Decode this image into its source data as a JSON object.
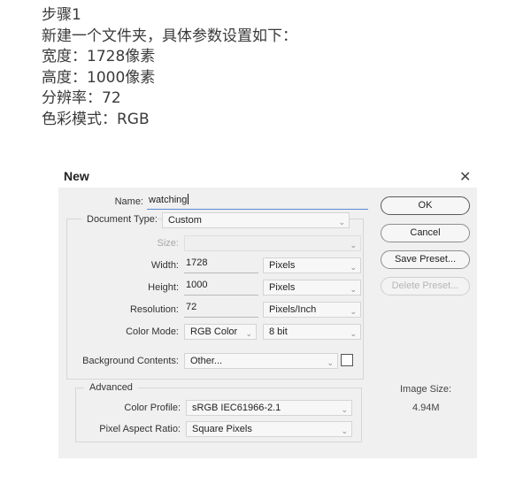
{
  "intro": {
    "lines": [
      "步骤1",
      "新建一个文件夹，具体参数设置如下：",
      "宽度：1728像素",
      "高度：1000像素",
      "分辨率：72",
      "色彩模式：RGB"
    ]
  },
  "dialog": {
    "title": "New",
    "close_glyph": "✕",
    "name_label": "Name:",
    "name_value": "watching",
    "doc_type_label": "Document Type:",
    "doc_type_value": "Custom",
    "size_label": "Size:",
    "size_value": "",
    "width_label": "Width:",
    "width_value": "1728",
    "width_unit": "Pixels",
    "height_label": "Height:",
    "height_value": "1000",
    "height_unit": "Pixels",
    "resolution_label": "Resolution:",
    "resolution_value": "72",
    "resolution_unit": "Pixels/Inch",
    "color_mode_label": "Color Mode:",
    "color_mode_value": "RGB Color",
    "bit_depth_value": "8 bit",
    "bg_label": "Background Contents:",
    "bg_value": "Other...",
    "advanced_title": "Advanced",
    "color_profile_label": "Color Profile:",
    "color_profile_value": "sRGB IEC61966-2.1",
    "par_label": "Pixel Aspect Ratio:",
    "par_value": "Square Pixels",
    "buttons": {
      "ok": "OK",
      "cancel": "Cancel",
      "save_preset": "Save Preset...",
      "delete_preset": "Delete Preset..."
    },
    "image_size_label": "Image Size:",
    "image_size_value": "4.94M"
  },
  "colors": {
    "panel_bg": "#f0f0f0",
    "focus_underline": "#5b8ad0",
    "disabled_text": "#a8a8a8"
  }
}
